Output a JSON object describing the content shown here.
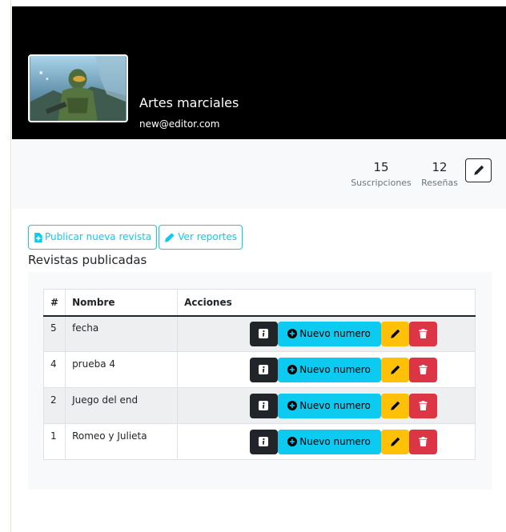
{
  "profile": {
    "name": "Artes marciales",
    "email": "new@editor.com"
  },
  "stats": {
    "subscriptions": {
      "value": "15",
      "label": "Suscripciones"
    },
    "reviews": {
      "value": "12",
      "label": "Reseñas"
    }
  },
  "actions": {
    "publish_label": "Publicar nueva revista",
    "reports_label": "Ver reportes"
  },
  "section": {
    "title": "Revistas publicadas"
  },
  "table": {
    "headers": {
      "num": "#",
      "name": "Nombre",
      "actions": "Acciones"
    },
    "rows": [
      {
        "num": "5",
        "name": "fecha"
      },
      {
        "num": "4",
        "name": "prueba 4"
      },
      {
        "num": "2",
        "name": "Juego del end"
      },
      {
        "num": "1",
        "name": "Romeo y Julieta"
      }
    ],
    "new_issue_label": "Nuevo numero"
  },
  "colors": {
    "header_bg": "#000000",
    "accent": "#0dcaf0",
    "warning": "#ffc107",
    "danger": "#dc3545",
    "dark": "#212529"
  },
  "icons": {
    "edit": "pencil-icon",
    "info": "info-icon",
    "add": "plus-circle-icon",
    "delete": "trash-icon",
    "file": "file-plus-icon"
  }
}
